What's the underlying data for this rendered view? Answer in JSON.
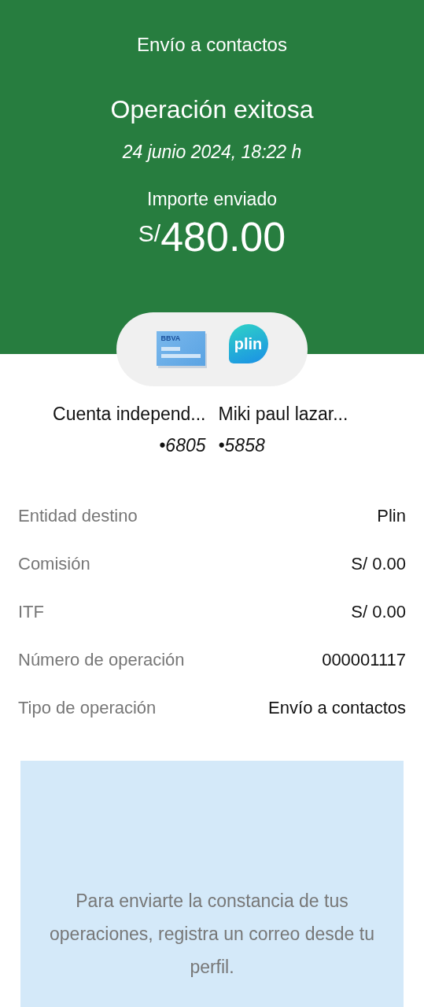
{
  "header": {
    "title": "Envío a contactos",
    "status": "Operación exitosa",
    "datetime": "24 junio 2024,  18:22 h",
    "amount_label": "Importe enviado",
    "currency": "S/",
    "amount": "480.00"
  },
  "transfer": {
    "from_logo": "BBVA",
    "to_logo": "plin",
    "from_name": "Cuenta independ...",
    "from_number": "•6805",
    "to_name": "Miki paul lazar...",
    "to_number": "•5858"
  },
  "details": [
    {
      "label": "Entidad destino",
      "value": "Plin"
    },
    {
      "label": "Comisión",
      "value": "S/ 0.00"
    },
    {
      "label": "ITF",
      "value": "S/ 0.00"
    },
    {
      "label": "Número de operación",
      "value": "000001117"
    },
    {
      "label": "Tipo de operación",
      "value": "Envío a contactos"
    }
  ],
  "notice": "Para enviarte la constancia de tus operaciones, registra un correo desde tu perfil."
}
